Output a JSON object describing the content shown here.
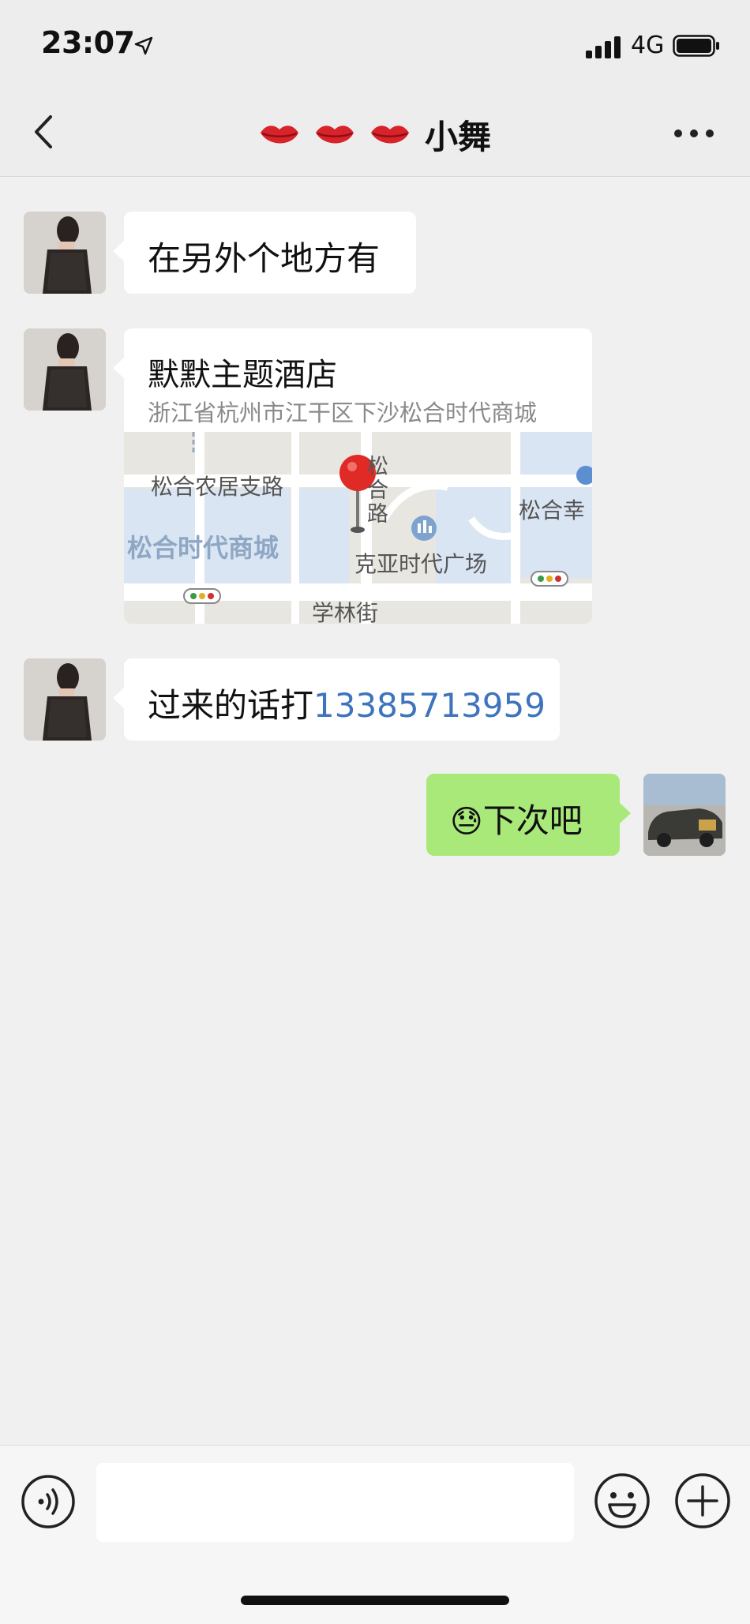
{
  "status_bar": {
    "time": "23:07",
    "network": "4G"
  },
  "nav": {
    "title": "小舞",
    "title_icon": "lips-icon",
    "back_icon": "chevron-left-icon",
    "more_icon": "more-icon"
  },
  "messages": [
    {
      "side": "left",
      "type": "text",
      "text": "在另外个地方有"
    },
    {
      "side": "left",
      "type": "location",
      "title": "默默主题酒店",
      "address": "浙江省杭州市江干区下沙松合时代商城",
      "map_labels": [
        "松合农居支路",
        "松合路",
        "松合幸",
        "松合时代商城",
        "克亚时代广场",
        "学林街"
      ]
    },
    {
      "side": "left",
      "type": "text",
      "text_prefix": "过来的话打",
      "phone": "13385713959"
    },
    {
      "side": "right",
      "type": "text",
      "emoji": "😓",
      "text": "下次吧"
    }
  ],
  "input_bar": {
    "voice_icon": "voice-icon",
    "emoji_icon": "emoji-icon",
    "plus_icon": "plus-icon",
    "placeholder": ""
  },
  "colors": {
    "bubble_self": "#a9e97a",
    "bubble_other": "#ffffff",
    "phone_link": "#3d74bd",
    "background": "#f0f0f0"
  }
}
